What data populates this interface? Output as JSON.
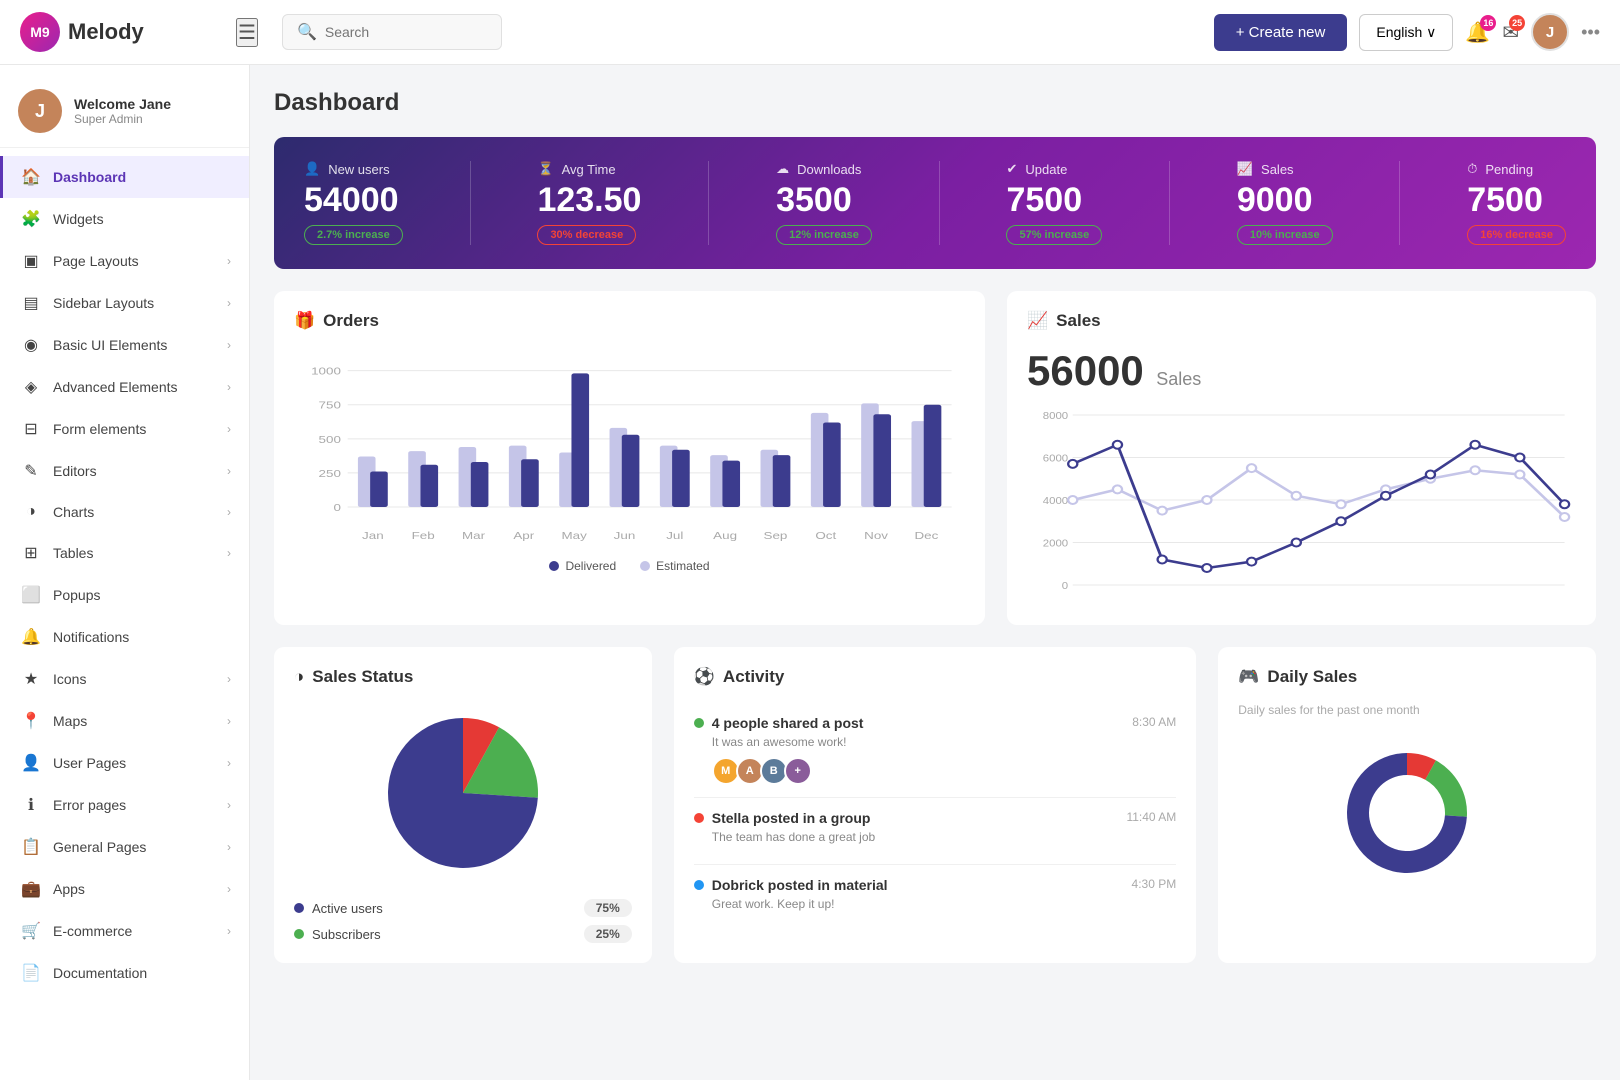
{
  "app": {
    "logo_letters": "M9",
    "logo_name": "Melody"
  },
  "topbar": {
    "hamburger": "☰",
    "search_placeholder": "Search",
    "create_label": "+ Create new",
    "lang_label": "English ∨",
    "notif1_count": "16",
    "notif2_count": "25",
    "more_icon": "•••"
  },
  "sidebar": {
    "user_name": "Welcome Jane",
    "user_role": "Super Admin",
    "user_initials": "J",
    "items": [
      {
        "label": "Dashboard",
        "icon": "🏠",
        "active": true,
        "has_arrow": false
      },
      {
        "label": "Widgets",
        "icon": "🧩",
        "active": false,
        "has_arrow": false
      },
      {
        "label": "Page Layouts",
        "icon": "▣",
        "active": false,
        "has_arrow": true
      },
      {
        "label": "Sidebar Layouts",
        "icon": "▤",
        "active": false,
        "has_arrow": true
      },
      {
        "label": "Basic UI Elements",
        "icon": "◉",
        "active": false,
        "has_arrow": true
      },
      {
        "label": "Advanced Elements",
        "icon": "◈",
        "active": false,
        "has_arrow": true
      },
      {
        "label": "Form elements",
        "icon": "⊟",
        "active": false,
        "has_arrow": true
      },
      {
        "label": "Editors",
        "icon": "✎",
        "active": false,
        "has_arrow": true
      },
      {
        "label": "Charts",
        "icon": "◑",
        "active": false,
        "has_arrow": true
      },
      {
        "label": "Tables",
        "icon": "⊞",
        "active": false,
        "has_arrow": true
      },
      {
        "label": "Popups",
        "icon": "⬜",
        "active": false,
        "has_arrow": false
      },
      {
        "label": "Notifications",
        "icon": "🔔",
        "active": false,
        "has_arrow": false
      },
      {
        "label": "Icons",
        "icon": "★",
        "active": false,
        "has_arrow": true
      },
      {
        "label": "Maps",
        "icon": "📍",
        "active": false,
        "has_arrow": true
      },
      {
        "label": "User Pages",
        "icon": "👤",
        "active": false,
        "has_arrow": true
      },
      {
        "label": "Error pages",
        "icon": "ℹ",
        "active": false,
        "has_arrow": true
      },
      {
        "label": "General Pages",
        "icon": "📋",
        "active": false,
        "has_arrow": true
      },
      {
        "label": "Apps",
        "icon": "💼",
        "active": false,
        "has_arrow": true
      },
      {
        "label": "E-commerce",
        "icon": "🛒",
        "active": false,
        "has_arrow": true
      },
      {
        "label": "Documentation",
        "icon": "📄",
        "active": false,
        "has_arrow": false
      }
    ]
  },
  "dashboard": {
    "title": "Dashboard",
    "stats": [
      {
        "icon": "👤",
        "label": "New users",
        "value": "54000",
        "badge": "2.7% increase",
        "badge_type": "green"
      },
      {
        "icon": "⏳",
        "label": "Avg Time",
        "value": "123.50",
        "badge": "30% decrease",
        "badge_type": "red"
      },
      {
        "icon": "☁",
        "label": "Downloads",
        "value": "3500",
        "badge": "12% increase",
        "badge_type": "green"
      },
      {
        "icon": "✔",
        "label": "Update",
        "value": "7500",
        "badge": "57% increase",
        "badge_type": "green"
      },
      {
        "icon": "📈",
        "label": "Sales",
        "value": "9000",
        "badge": "10% increase",
        "badge_type": "green"
      },
      {
        "icon": "⏱",
        "label": "Pending",
        "value": "7500",
        "badge": "16% decrease",
        "badge_type": "red"
      }
    ],
    "orders": {
      "title": "Orders",
      "legend_delivered": "Delivered",
      "legend_estimated": "Estimated",
      "months": [
        "Jan",
        "Feb",
        "Mar",
        "Apr",
        "May",
        "Jun",
        "Jul",
        "Aug",
        "Sep",
        "Oct",
        "Nov",
        "Dec"
      ],
      "delivered": [
        260,
        310,
        330,
        350,
        980,
        530,
        420,
        340,
        380,
        620,
        680,
        750
      ],
      "estimated": [
        370,
        410,
        440,
        450,
        400,
        580,
        450,
        380,
        420,
        690,
        760,
        630
      ],
      "y_labels": [
        "0",
        "250",
        "500",
        "750",
        "1000"
      ]
    },
    "sales": {
      "title": "Sales",
      "value": "56000",
      "label": "Sales",
      "y_labels": [
        "0",
        "2000",
        "4000",
        "6000",
        "8000"
      ],
      "series1": [
        5700,
        6600,
        1200,
        800,
        1100,
        2000,
        3000,
        4200,
        5200,
        6600,
        6000,
        3800
      ],
      "series2": [
        4000,
        4500,
        3500,
        4000,
        5500,
        4200,
        3800,
        4500,
        5000,
        5400,
        5200,
        3200
      ]
    },
    "sales_status": {
      "title": "Sales Status",
      "legend": [
        {
          "label": "Active users",
          "color": "#3c3c8e",
          "value": "75%"
        },
        {
          "label": "Subscribers",
          "color": "#4caf50",
          "value": "25%"
        }
      ]
    },
    "activity": {
      "title": "Activity",
      "items": [
        {
          "dot_color": "#4caf50",
          "title": "4 people shared a post",
          "sub": "It was an awesome work!",
          "time": "8:30 AM",
          "has_avatars": true
        },
        {
          "dot_color": "#f44336",
          "title": "Stella posted in a group",
          "sub": "The team has done a great job",
          "time": "11:40 AM",
          "has_avatars": false
        },
        {
          "dot_color": "#2196f3",
          "title": "Dobrick posted in material",
          "sub": "Great work. Keep it up!",
          "time": "4:30 PM",
          "has_avatars": false
        }
      ]
    },
    "daily_sales": {
      "title": "Daily Sales",
      "subtitle": "Daily sales for the past one month"
    }
  }
}
